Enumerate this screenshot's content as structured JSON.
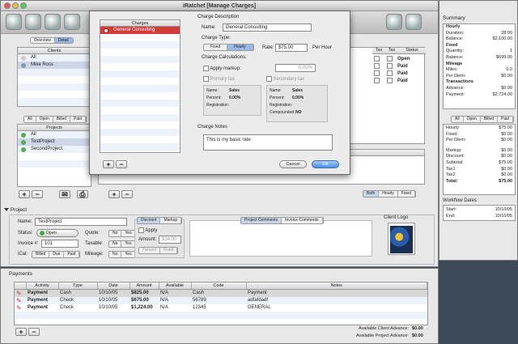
{
  "window": {
    "title": "iRatchet [Manage Charges]"
  },
  "view_tabs": [
    "Overview",
    "Detail"
  ],
  "clients": {
    "header": "Clients",
    "items": [
      "All",
      "Mike Ross"
    ],
    "filters": [
      "All",
      "Open",
      "Billed",
      "Paid"
    ]
  },
  "projects": {
    "header": "Projects",
    "items": [
      "All",
      "TestProject",
      "SecondProject"
    ]
  },
  "charges_table": {
    "headers": [
      "Tax",
      "Tax",
      "Status"
    ],
    "statuses": [
      "Open",
      "Paid",
      "Paid",
      "Paid"
    ],
    "bottom_tabs": [
      "Both",
      "Hourly",
      "Fixed"
    ]
  },
  "sheet": {
    "charges_header": "Charges",
    "charges": [
      "General Consulting"
    ],
    "charge_description_label": "Charge Description",
    "name_label": "Name:",
    "name_value": "General Consulting",
    "charge_type_label": "Charge Type:",
    "type_fixed": "Fixed",
    "type_hourly": "Hourly",
    "rate_label": "Rate:",
    "rate_value": "$75.00",
    "per_hour": "Per Hour",
    "calculations_label": "Charge Calculations:",
    "apply_markup": "Apply markup:",
    "markup_value": "0.00%",
    "primary_tax": "Primary tax",
    "secondary_tax": "Secondary tax",
    "tax1": {
      "name_l": "Name:",
      "name": "Sales",
      "percent_l": "Percent:",
      "percent": "0.00%",
      "reg_l": "Registration:"
    },
    "tax2": {
      "name_l": "Name:",
      "name": "Sales",
      "percent_l": "Percent:",
      "percent": "0.00%",
      "reg_l": "Registration:",
      "comp_l": "Compounded:",
      "comp": "NO"
    },
    "notes_label": "Charge Notes",
    "notes_value": "This is my basic rate",
    "cancel": "Cancel",
    "ok": "Ok"
  },
  "project": {
    "section": "Project",
    "name_label": "Name:",
    "name_value": "TestProject",
    "status_label": "Status:",
    "status_value": "Open",
    "invoice_label": "Invoice #:",
    "invoice_value": "101",
    "ical_label": "iCal:",
    "ical_options": [
      "Billed",
      "Due",
      "Paid"
    ],
    "quote_label": "Quote:",
    "taxable_label": "Taxable:",
    "mileage_label": "Mileage:",
    "no": "No",
    "yes": "Yes",
    "discount_tabs": [
      "Discount",
      "Markup"
    ],
    "apply": "Apply",
    "amount_label": "Amount:",
    "amount_value": "$34.00",
    "percent_fixed": [
      "Percent",
      "Fixed"
    ],
    "comment_tabs": [
      "Project Comments",
      "Invoice Comments"
    ],
    "logo_label": "Client Logo"
  },
  "summary": {
    "title": "Summary",
    "hourly_h": "Hourly",
    "duration_l": "Duration:",
    "duration": "28:00",
    "balance_l": "Balance:",
    "balance": "$2,100.00",
    "fixed_h": "Fixed",
    "quantity_l": "Quantity:",
    "quantity": "1",
    "balance2": "$699.00",
    "mileage_h": "Mileage",
    "miles_l": "Miles:",
    "miles": "0.0",
    "perdiem_l": "Per Diem:",
    "perdiem": "$0.00",
    "transactions_h": "Transactions",
    "advance_l": "Advance:",
    "advance": "$0.00",
    "payment_l": "Payment:",
    "payment": "$2,724.00",
    "filters": [
      "All",
      "Open",
      "Billed",
      "Paid"
    ],
    "hourly_l": "Hourly:",
    "hourly": "$75.00",
    "fixed_l": "Fixed:",
    "fixed": "$0.00",
    "perdiem2": "$0.00",
    "markup_l": "Markup:",
    "markup": "$0.00",
    "discount_l": "Discount:",
    "discount": "$0.00",
    "subtotal_l": "Subtotal:",
    "subtotal": "$75.00",
    "tax1_l": "Tax1",
    "tax1": "$0.00",
    "tax2_l": "Tax2",
    "tax2": "$0.00",
    "total_l": "Total:",
    "total": "$75.00",
    "workflow": "Workflow Dates",
    "start_l": "Start:",
    "start": "10/10/05",
    "end_l": "End:",
    "end": "10/10/05"
  },
  "payments": {
    "title": "Payments",
    "headers": [
      "Activity",
      "Type",
      "Date",
      "Amount",
      "Available",
      "Code",
      "Notes"
    ],
    "rows": [
      [
        "Payment",
        "Cash",
        "10/10/05",
        "$825.00",
        "N/A",
        "Cash",
        "Payment"
      ],
      [
        "Payment",
        "Check",
        "10/10/05",
        "$675.00",
        "N/A",
        "56789",
        "adfafdadf"
      ],
      [
        "Payment",
        "Check",
        "10/10/05",
        "$1,224.00",
        "N/A",
        "12345",
        "GENERAL"
      ]
    ],
    "client_adv_l": "Available Client Advance:",
    "client_adv": "$0.00",
    "project_adv_l": "Available Project Advance:",
    "project_adv": "$0.00"
  },
  "colors": {
    "selection": "#d33a3a",
    "accent": "#4b8de0",
    "green": "#3fae3f"
  }
}
